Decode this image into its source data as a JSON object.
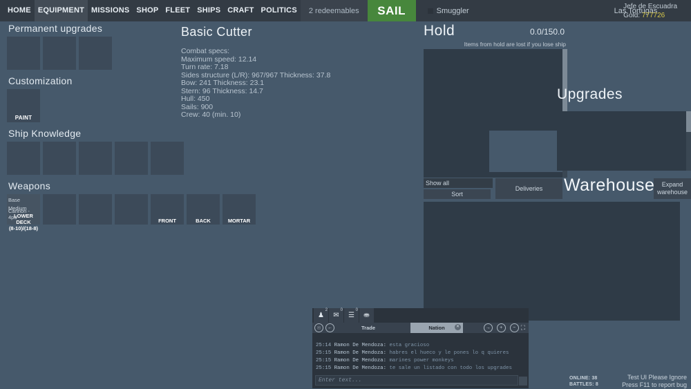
{
  "topbar": {
    "nav_items": [
      {
        "label": "HOME",
        "active": false
      },
      {
        "label": "EQUIPMENT",
        "active": true
      },
      {
        "label": "MISSIONS",
        "active": false
      },
      {
        "label": "SHOP",
        "active": false
      },
      {
        "label": "FLEET",
        "active": false
      },
      {
        "label": "SHIPS",
        "active": false
      },
      {
        "label": "CRAFT",
        "active": false
      },
      {
        "label": "POLITICS",
        "active": false
      }
    ],
    "redeemables": "2 redeemables",
    "sail_label": "SAIL",
    "smuggler_label": "Smuggler",
    "port": "Las Tortugas",
    "rank": "Jefe de Escuadra",
    "gold_label": "Gold:",
    "gold_value": "777726",
    "accent_sail": "#47873c",
    "accent_gold": "#d8c84a"
  },
  "left": {
    "permanent_title": "Permanent upgrades",
    "permanent_slots": [
      {
        "label": ""
      },
      {
        "label": ""
      },
      {
        "label": ""
      }
    ],
    "customization_title": "Customization",
    "customization_slots": [
      {
        "label": "PAINT"
      }
    ],
    "ship_knowledge_title": "Ship Knowledge",
    "ship_knowledge_slots": [
      {
        "label": ""
      },
      {
        "label": ""
      },
      {
        "label": ""
      },
      {
        "label": ""
      },
      {
        "label": ""
      }
    ],
    "weapons_title": "Weapons",
    "weapon_slots": [
      {
        "name": "Base Medium",
        "name2": "Cannon - 4pd",
        "deck": "LOWER DECK",
        "deck2": "(8-10)/(18-8)",
        "filled": true
      },
      {
        "name": "",
        "name2": "",
        "deck": "",
        "deck2": "",
        "filled": false
      },
      {
        "name": "",
        "name2": "",
        "deck": "",
        "deck2": "",
        "filled": false
      },
      {
        "name": "",
        "name2": "",
        "deck": "",
        "deck2": "",
        "filled": false
      },
      {
        "name": "",
        "name2": "",
        "deck": "FRONT",
        "deck2": "",
        "filled": false
      },
      {
        "name": "",
        "name2": "",
        "deck": "BACK",
        "deck2": "",
        "filled": false
      },
      {
        "name": "",
        "name2": "",
        "deck": "MORTAR",
        "deck2": "",
        "filled": false
      }
    ]
  },
  "specs": {
    "ship_name": "Basic Cutter",
    "header": "Combat specs:",
    "lines": [
      "Maximum speed: 12.14",
      "Turn rate: 7.18",
      "Sides structure (L/R): 967/967 Thickness: 37.8",
      "Bow: 241 Thickness: 23.1",
      "Stern: 96 Thickness: 14.7",
      "Hull: 450",
      "Sails: 900",
      "Crew: 40 (min. 10)"
    ]
  },
  "hold": {
    "title": "Hold",
    "capacity": "0.0/150.0",
    "note": "Items from hold are lost if you lose ship",
    "items": []
  },
  "upgrades": {
    "title": "Upgrades",
    "items": []
  },
  "warehouse": {
    "title": "Warehouse",
    "show_all_label": "Show all",
    "sort_label": "Sort",
    "deliveries_label": "Deliveries",
    "expand_line1": "Expand",
    "expand_line2": "warehouse",
    "items": []
  },
  "chat": {
    "tabs": [
      {
        "icon": "person-icon",
        "badge": "2"
      },
      {
        "icon": "envelope-icon",
        "badge": "0"
      },
      {
        "icon": "list-icon",
        "badge": "0"
      },
      {
        "icon": "group-icon",
        "badge": ""
      }
    ],
    "channel_trade": "Trade",
    "channel_nation": "Nation",
    "messages": [
      {
        "time": "25:14",
        "user": "Ramon De Mendoza",
        "text": "esta gracioso"
      },
      {
        "time": "25:15",
        "user": "Ramon De Mendoza",
        "text": "habres el hueco y le pones lo q quieres"
      },
      {
        "time": "25:15",
        "user": "Ramon De Mendoza",
        "text": "marines  power monkeys"
      },
      {
        "time": "25:15",
        "user": "Ramon De Mendoza",
        "text": "te sale un listado con todo los upgrades"
      }
    ],
    "input_placeholder": "Enter text..."
  },
  "status": {
    "online": "ONLINE: 38",
    "battles": "BATTLES: 8",
    "test_line1": "Test UI Please Ignore",
    "test_line2": "Press F11 to report bug"
  }
}
